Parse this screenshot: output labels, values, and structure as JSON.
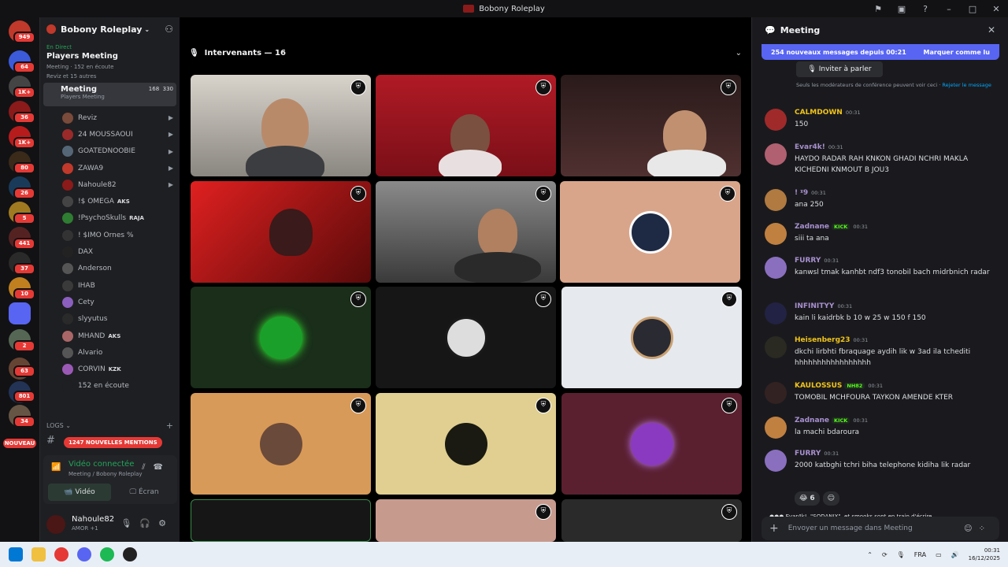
{
  "window": {
    "title": "Bobony Roleplay"
  },
  "rail": {
    "badges": [
      "949",
      "64",
      "1K+",
      "36",
      "1K+",
      "80",
      "26",
      "5",
      "441",
      "37",
      "10",
      "2",
      "63",
      "801",
      "34"
    ],
    "new_label": "NOUVEAU"
  },
  "sidebar": {
    "server_name": "Bobony Roleplay",
    "live_label": "En Direct",
    "event_title": "Players Meeting",
    "event_meta": "Meeting  ·  152 en écoute",
    "event_meta2": "Reviz et 15 autres",
    "meeting": {
      "name": "Meeting",
      "sub": "Players Meeting",
      "count1": "168",
      "count2": "330"
    },
    "members": [
      {
        "name": "Reviz",
        "color": "#7a4a3a",
        "cam": true
      },
      {
        "name": "24 MOUSSAOUI",
        "color": "#9a2a2a",
        "cam": true
      },
      {
        "name": "GOATEDNOOBIE",
        "color": "#556677",
        "cam": true
      },
      {
        "name": "ZAWA9",
        "color": "#c0392b",
        "cam": true
      },
      {
        "name": "Nahoule82",
        "color": "#8b1a1a",
        "cam": true
      },
      {
        "name": "!$ OMEGA",
        "color": "#444",
        "tag": "AKS"
      },
      {
        "name": "!PsychoSkulls",
        "color": "#2e7d32",
        "tag": "RAJA"
      },
      {
        "name": "! $IMO Ornes %",
        "color": "#333"
      },
      {
        "name": "DAX",
        "color": "#222"
      },
      {
        "name": "Anderson",
        "color": "#555"
      },
      {
        "name": "IHAB",
        "color": "#3a3a3a"
      },
      {
        "name": "Cety",
        "color": "#8a5fbf"
      },
      {
        "name": "slyyutus",
        "color": "#2a2a2a"
      },
      {
        "name": "MHAND",
        "color": "#aa6666",
        "tag": "AKS"
      },
      {
        "name": "Alvario",
        "color": "#555"
      },
      {
        "name": "CORVIN",
        "color": "#9b59b6",
        "tag": "KZK"
      },
      {
        "name": "152 en écoute",
        "color": "#1e1f22"
      }
    ],
    "logs_label": "LOGS",
    "mentions_label": "1247 NOUVELLES MENTIONS",
    "voice": {
      "title": "Vidéo connectée",
      "sub": "Meeting  /  Bobony Roleplay",
      "video_label": "Vidéo",
      "screen_label": "Écran"
    },
    "user": {
      "name": "Nahoule82",
      "status": "AMOR +1"
    }
  },
  "stage": {
    "header": "Intervenants — 16"
  },
  "chat": {
    "title": "Meeting",
    "new_messages": "254 nouveaux messages depuis 00:21",
    "mark_read": "Marquer comme lu",
    "invite_label": "Inviter à parler",
    "mod_note": "Seuls les modérateurs de conférence peuvent voir ceci · ",
    "mod_link": "Rejeter le message",
    "messages": [
      {
        "author": "CALMDOWN",
        "time": "00:31",
        "text": "150",
        "color": "#f0c419",
        "avatar": "#a02a2a"
      },
      {
        "author": "Evar4k!",
        "time": "00:31",
        "text": "HAYDO RADAR RAH KNKON GHADI NCHRI MAKLA KICHEDNI KNMOUT B JOU3",
        "color": "#a890d0",
        "avatar": "#b06070"
      },
      {
        "author": "! ᵡ9",
        "time": "00:31",
        "text": "ana 250",
        "color": "#a890d0",
        "avatar": "#b07a40"
      },
      {
        "author": "Zadnane",
        "time": "00:31",
        "text": "siii ta ana",
        "color": "#a890d0",
        "avatar": "#c08040",
        "kick": "KICK"
      },
      {
        "author": "FURRY",
        "time": "00:31",
        "text": "kanwsl tmak kanhbt ndf3 tonobil bach midrbnich radar",
        "color": "#a890d0",
        "avatar": "#8a6fbf"
      },
      {
        "author": "INFINITYY",
        "time": "00:31",
        "text": "kain li kaidrbk b 10 w 25 w 150 f 150",
        "color": "#a890d0",
        "avatar": "#222244"
      },
      {
        "author": "Heisenberg23",
        "time": "00:31",
        "text": "dkchi lirbhti fbraquage aydih lik w 3ad ila tchediti hhhhhhhhhhhhhhhhh",
        "color": "#f0c419",
        "avatar": "#2a2a22"
      },
      {
        "author": "KAULOSSUS",
        "time": "00:31",
        "text": "TOMOBIL MCHFOURA TAYKON AMENDE KTER",
        "color": "#f0c419",
        "avatar": "#332222",
        "kick": "NH82"
      },
      {
        "author": "Zadnane",
        "time": "00:31",
        "text": "la machi bdaroura",
        "color": "#a890d0",
        "avatar": "#c08040",
        "kick": "KICK"
      },
      {
        "author": "FURRY",
        "time": "00:31",
        "text": "2000 katbghi tchri biha telephone kidiha lik radar",
        "color": "#a890d0",
        "avatar": "#8a6fbf"
      }
    ],
    "reaction_count": "6",
    "typing": "Evar4k!, \"SODANIX\", et smooks sont en train d'écrire...",
    "placeholder": "Envoyer un message dans Meeting"
  },
  "taskbar": {
    "lang": "FRA",
    "time": "00:31",
    "date": "16/12/2025"
  }
}
